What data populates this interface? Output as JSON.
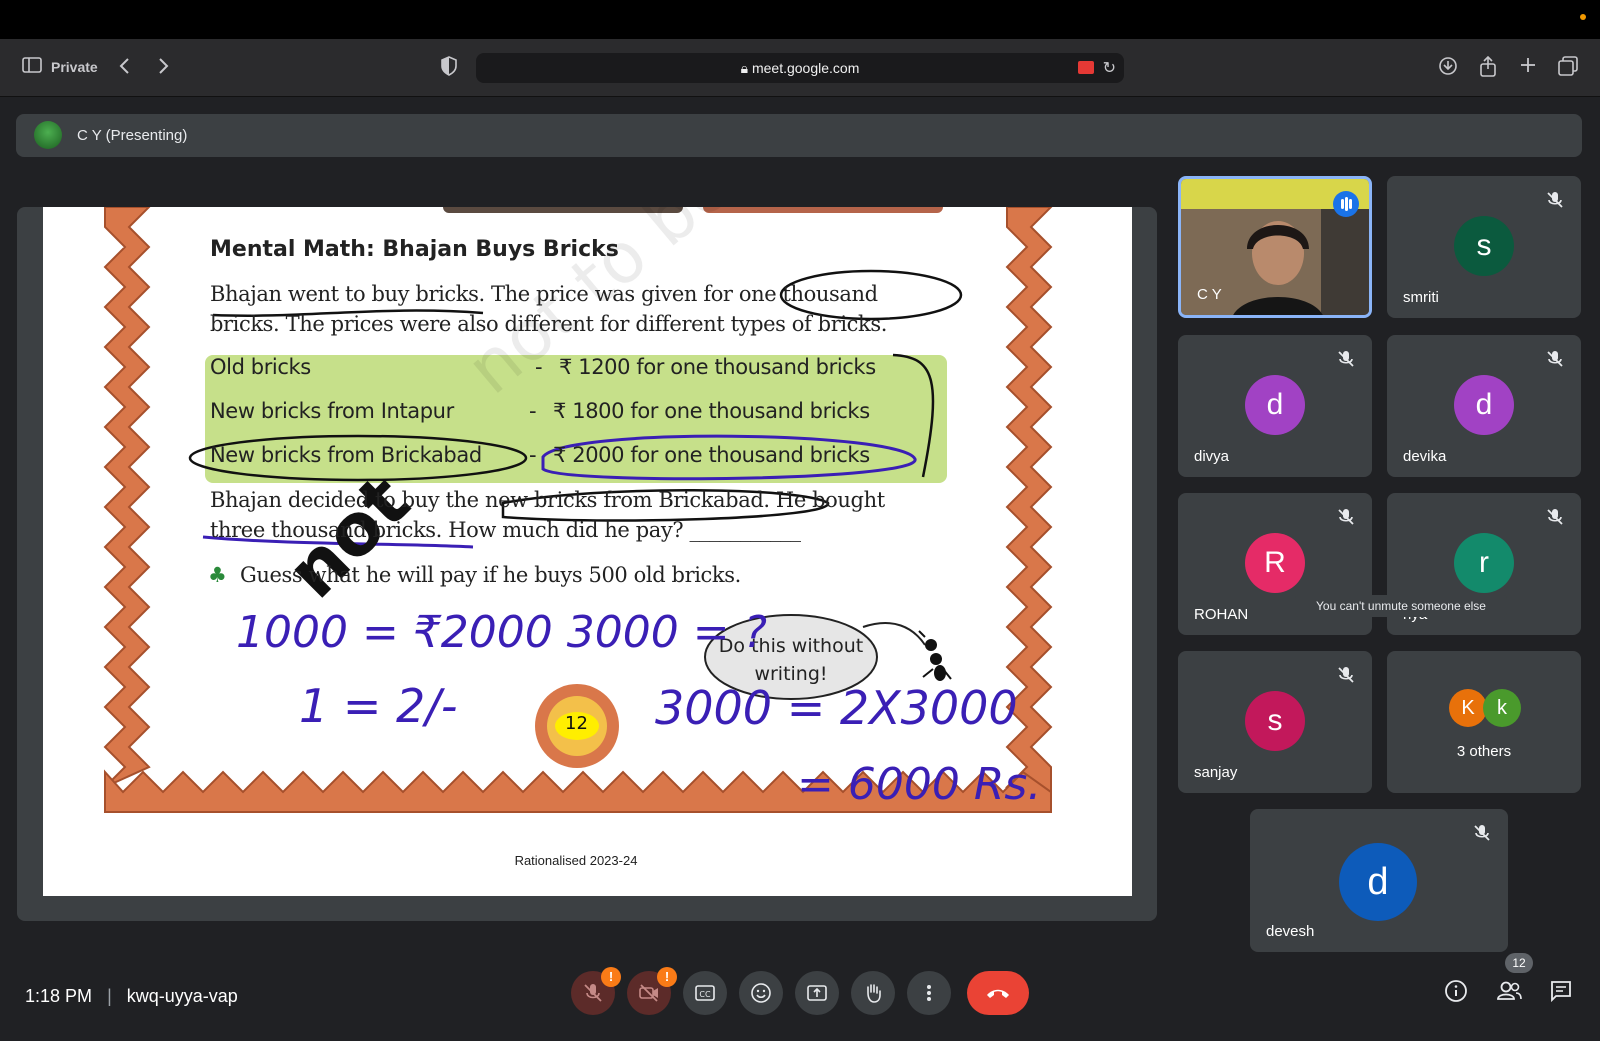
{
  "browser": {
    "mode_label": "Private",
    "url": "meet.google.com"
  },
  "presenting": {
    "label": "C Y (Presenting)"
  },
  "slide": {
    "title": "Mental Math: Bhajan Buys Bricks",
    "line1": "Bhajan went to buy bricks. The price was given for one thousand",
    "line2": "bricks. The prices were also different for different types of bricks.",
    "rows": [
      {
        "label": "Old bricks",
        "dash": "-",
        "price": "₹ 1200 for one thousand bricks"
      },
      {
        "label": "New bricks from Intapur",
        "dash": "-",
        "price": "₹ 1800 for one thousand bricks"
      },
      {
        "label": "New bricks from Brickabad",
        "dash": "-",
        "price": "₹ 2000 for one thousand bricks"
      }
    ],
    "para1": "Bhajan decided to buy the new bricks from Brickabad. He bought",
    "para2": "three thousand bricks. How much did he pay? ___________",
    "guess": "Guess what he will pay if he buys 500 old bricks.",
    "bubble_line1": "Do this without",
    "bubble_line2": "writing!",
    "page_badge": "12",
    "footer": "Rationalised 2023-24",
    "annotations": {
      "overlay_word": "not",
      "hw1": "1000 = ₹2000 3000 = ?",
      "hw2": "1 = 2/-",
      "hw3": "3000 = 2X3000",
      "hw4": "= 6000 Rs."
    }
  },
  "participants": [
    {
      "name": "C Y",
      "initial": "",
      "color": "",
      "video": true
    },
    {
      "name": "smriti",
      "initial": "s",
      "color": "#0b5a3e"
    },
    {
      "name": "divya",
      "initial": "d",
      "color": "#a142c4"
    },
    {
      "name": "devika",
      "initial": "d",
      "color": "#a142c4"
    },
    {
      "name": "ROHAN",
      "initial": "R",
      "color": "#e52b67"
    },
    {
      "name": "riya",
      "initial": "r",
      "color": "#138a6b"
    },
    {
      "name": "sanjay",
      "initial": "s",
      "color": "#c2185b"
    },
    {
      "name": "devesh",
      "initial": "d",
      "color": "#0d5bba"
    }
  ],
  "others_tile": {
    "label": "3 others",
    "avatars": [
      {
        "initial": "K",
        "color": "#e8710a"
      },
      {
        "initial": "k",
        "color": "#4a9a2c"
      }
    ]
  },
  "tooltip": "You can't unmute someone else",
  "bottom": {
    "time": "1:18 PM",
    "separator": "|",
    "meeting_code": "kwq-uyya-vap",
    "people_count": "12",
    "mic_warning": "!",
    "cam_warning": "!"
  }
}
